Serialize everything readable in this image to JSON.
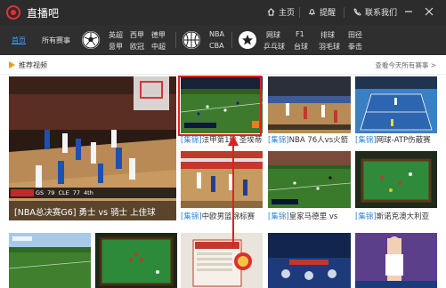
{
  "titlebar": {
    "app_title": "直播吧",
    "home": "主页",
    "remind": "提醒",
    "contact": "联系我们"
  },
  "nav": {
    "home": "首页",
    "all": "所有赛事",
    "soccer": [
      "英超",
      "西甲",
      "德甲",
      "意甲",
      "欧冠",
      "中超"
    ],
    "basketball": [
      "NBA",
      "CBA"
    ],
    "other": [
      "网球",
      "F1",
      "排球",
      "田径",
      "乒乓球",
      "台球",
      "羽毛球",
      "拳击"
    ]
  },
  "section": {
    "title": "推荐视频",
    "more": "查看今天所有赛事 >"
  },
  "videos": {
    "big": {
      "caption": "[NBA总决赛G6] 勇士 vs 骑士 上佳球"
    },
    "scoreboard": {
      "home": "GS",
      "home_score": "79",
      "away": "CLE",
      "away_score": "77",
      "qtr": "4th"
    },
    "row1": [
      {
        "tag": "[集锦]",
        "title": "法甲第1轮 圣埃蒂安"
      },
      {
        "tag": "[集锦]",
        "title": "NBA 76人vs火箭"
      },
      {
        "tag": "[集锦]",
        "title": "网球-ATP伤蔽赛"
      }
    ],
    "row2": [
      {
        "tag": "[集锦]",
        "title": "中欧男篮锦标赛"
      },
      {
        "tag": "[集锦]",
        "title": "皇家马德里 vs"
      },
      {
        "tag": "[集锦]",
        "title": "斯诺克澳大利亚"
      }
    ]
  },
  "colors": {
    "accent_red": "#e02020",
    "link_blue": "#2f84d6",
    "dark_bar": "#2c2c2c"
  }
}
